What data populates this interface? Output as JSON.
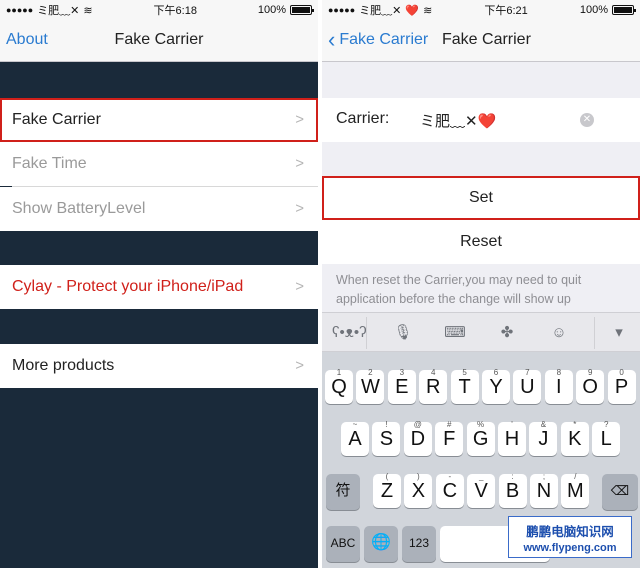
{
  "left": {
    "status": {
      "carrier": "ミ肥﹏✕",
      "time": "下午6:18",
      "battery": "100%"
    },
    "nav": {
      "back_label": "About",
      "title": "Fake Carrier"
    },
    "items": [
      {
        "label": "Fake Carrier"
      },
      {
        "label": "Fake Time"
      },
      {
        "label": "Show BatteryLevel"
      },
      {
        "label": "Cylay - Protect your iPhone/iPad"
      },
      {
        "label": "More products"
      }
    ]
  },
  "right": {
    "status": {
      "carrier": "ミ肥﹏✕",
      "carrier_heart": "❤️",
      "time": "下午6:21",
      "battery": "100%"
    },
    "nav": {
      "back_label": "Fake Carrier",
      "title": "Fake Carrier"
    },
    "carrier_field": {
      "label": "Carrier:",
      "value": "ミ肥﹏✕❤️"
    },
    "buttons": {
      "set": "Set",
      "reset": "Reset"
    },
    "note": "When reset the Carrier,you may need to quit application before the change will show up",
    "keyboard": {
      "row1": [
        {
          "k": "Q",
          "n": "1"
        },
        {
          "k": "W",
          "n": "2"
        },
        {
          "k": "E",
          "n": "3"
        },
        {
          "k": "R",
          "n": "4"
        },
        {
          "k": "T",
          "n": "5"
        },
        {
          "k": "Y",
          "n": "6"
        },
        {
          "k": "U",
          "n": "7"
        },
        {
          "k": "I",
          "n": "8"
        },
        {
          "k": "O",
          "n": "9"
        },
        {
          "k": "P",
          "n": "0"
        }
      ],
      "row2": [
        {
          "k": "A",
          "n": "~"
        },
        {
          "k": "S",
          "n": "!"
        },
        {
          "k": "D",
          "n": "@"
        },
        {
          "k": "F",
          "n": "#"
        },
        {
          "k": "G",
          "n": "%"
        },
        {
          "k": "H",
          "n": "'"
        },
        {
          "k": "J",
          "n": "&"
        },
        {
          "k": "K",
          "n": "*"
        },
        {
          "k": "L",
          "n": "?"
        }
      ],
      "row3": [
        {
          "k": "Z",
          "n": "("
        },
        {
          "k": "X",
          "n": ")"
        },
        {
          "k": "C",
          "n": "-"
        },
        {
          "k": "V",
          "n": "_"
        },
        {
          "k": "B",
          "n": ":"
        },
        {
          "k": "N",
          "n": ";"
        },
        {
          "k": "M",
          "n": "/"
        }
      ],
      "symbol_key": "符",
      "abc_key": "ABC",
      "num_key": "123"
    },
    "watermark": {
      "line1": "鹏鹏电脑知识网",
      "line2": "www.flypeng.com"
    }
  }
}
